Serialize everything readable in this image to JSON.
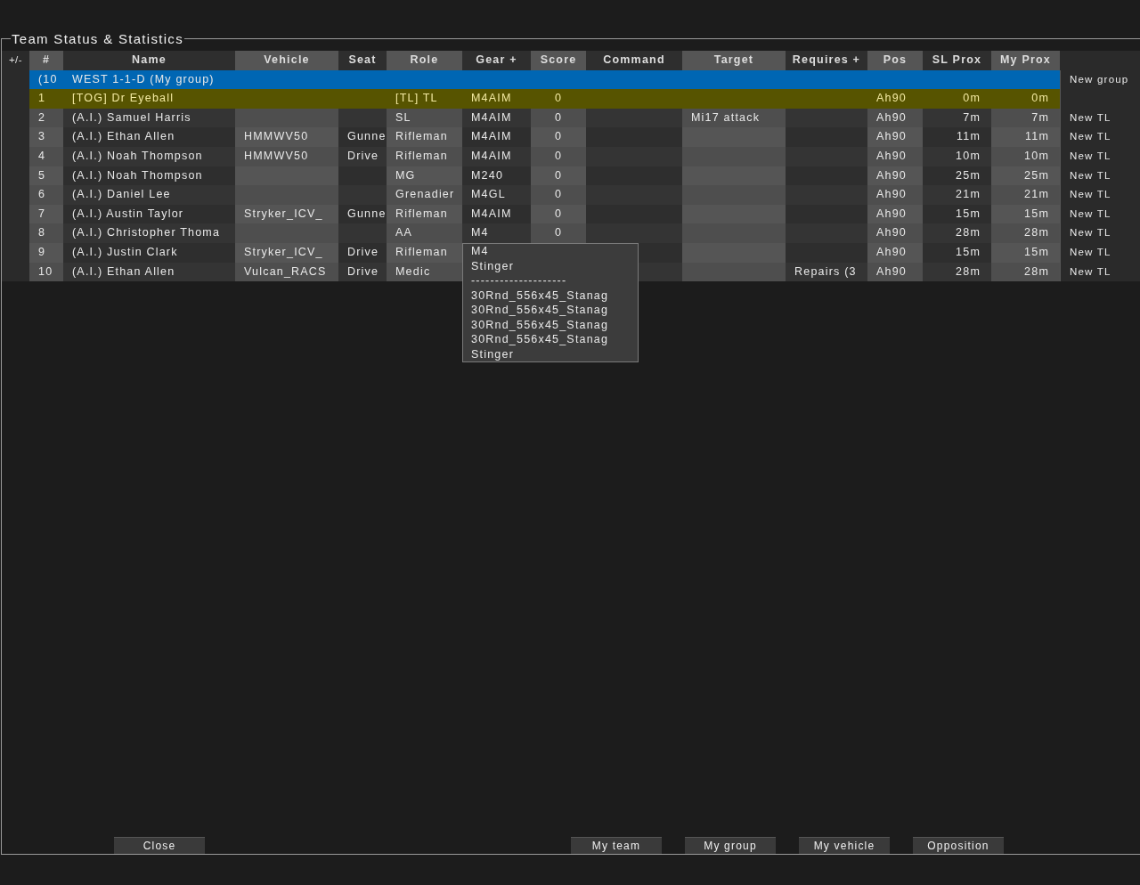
{
  "window": {
    "title": "Team Status & Statistics"
  },
  "table": {
    "columns": [
      "+/-",
      "#",
      "Name",
      "Vehicle",
      "Seat",
      "Role",
      "Gear +",
      "Score",
      "Command",
      "Target",
      "Requires +",
      "Pos",
      "SL Prox",
      "My Prox"
    ],
    "group": {
      "number": "(10",
      "name": "WEST 1-1-D (My group)",
      "action": "New group"
    },
    "rows": [
      {
        "selected": true,
        "number": "1",
        "name": "[TOG] Dr Eyeball",
        "role": "[TL] TL",
        "gear": "M4AIM",
        "score": "0",
        "pos": "Ah90",
        "sl_prox": "0m",
        "my_prox": "0m"
      },
      {
        "selected": false,
        "number": "2",
        "name": "(A.I.) Samuel Harris",
        "role": "SL",
        "gear": "M4AIM",
        "score": "0",
        "target": "Mi17 attack",
        "pos": "Ah90",
        "sl_prox": "7m",
        "my_prox": "7m",
        "action": "New TL"
      },
      {
        "selected": false,
        "number": "3",
        "name": "(A.I.) Ethan Allen",
        "vehicle": "HMMWV50",
        "seat": "Gunne",
        "role": "Rifleman",
        "gear": "M4AIM",
        "score": "0",
        "pos": "Ah90",
        "sl_prox": "11m",
        "my_prox": "11m",
        "action": "New TL"
      },
      {
        "selected": false,
        "number": "4",
        "name": "(A.I.) Noah Thompson",
        "vehicle": "HMMWV50",
        "seat": "Drive",
        "role": "Rifleman",
        "gear": "M4AIM",
        "score": "0",
        "pos": "Ah90",
        "sl_prox": "10m",
        "my_prox": "10m",
        "action": "New TL"
      },
      {
        "selected": false,
        "number": "5",
        "name": "(A.I.) Noah Thompson",
        "role": "MG",
        "gear": "M240",
        "score": "0",
        "pos": "Ah90",
        "sl_prox": "25m",
        "my_prox": "25m",
        "action": "New TL"
      },
      {
        "selected": false,
        "number": "6",
        "name": "(A.I.) Daniel Lee",
        "role": "Grenadier",
        "gear": "M4GL",
        "score": "0",
        "pos": "Ah90",
        "sl_prox": "21m",
        "my_prox": "21m",
        "action": "New TL"
      },
      {
        "selected": false,
        "number": "7",
        "name": "(A.I.) Austin Taylor",
        "vehicle": "Stryker_ICV_",
        "seat": "Gunne",
        "role": "Rifleman",
        "gear": "M4AIM",
        "score": "0",
        "pos": "Ah90",
        "sl_prox": "15m",
        "my_prox": "15m",
        "action": "New TL"
      },
      {
        "selected": false,
        "number": "8",
        "name": "(A.I.) Christopher Thoma",
        "role": "AA",
        "gear": "M4",
        "score": "0",
        "pos": "Ah90",
        "sl_prox": "28m",
        "my_prox": "28m",
        "action": "New TL"
      },
      {
        "selected": false,
        "number": "9",
        "name": "(A.I.) Justin Clark",
        "vehicle": "Stryker_ICV_",
        "seat": "Drive",
        "role": "Rifleman",
        "pos": "Ah90",
        "sl_prox": "15m",
        "my_prox": "15m",
        "action": "New TL"
      },
      {
        "selected": false,
        "number": "10",
        "name": "(A.I.) Ethan Allen",
        "vehicle": "Vulcan_RACS",
        "seat": "Drive",
        "role": "Medic",
        "requires": "Repairs (3",
        "pos": "Ah90",
        "sl_prox": "28m",
        "my_prox": "28m",
        "action": "New TL"
      }
    ],
    "gear_tooltip": [
      "M4",
      "Stinger",
      "--------------------",
      "30Rnd_556x45_Stanag",
      "30Rnd_556x45_Stanag",
      "30Rnd_556x45_Stanag",
      "30Rnd_556x45_Stanag",
      "Stinger"
    ]
  },
  "buttons": [
    {
      "label": "Close",
      "kind": "left"
    },
    {
      "label": "My team",
      "kind": "right"
    },
    {
      "label": "My group",
      "kind": "right"
    },
    {
      "label": "My vehicle",
      "kind": "right"
    },
    {
      "label": "Opposition",
      "kind": "right"
    }
  ]
}
